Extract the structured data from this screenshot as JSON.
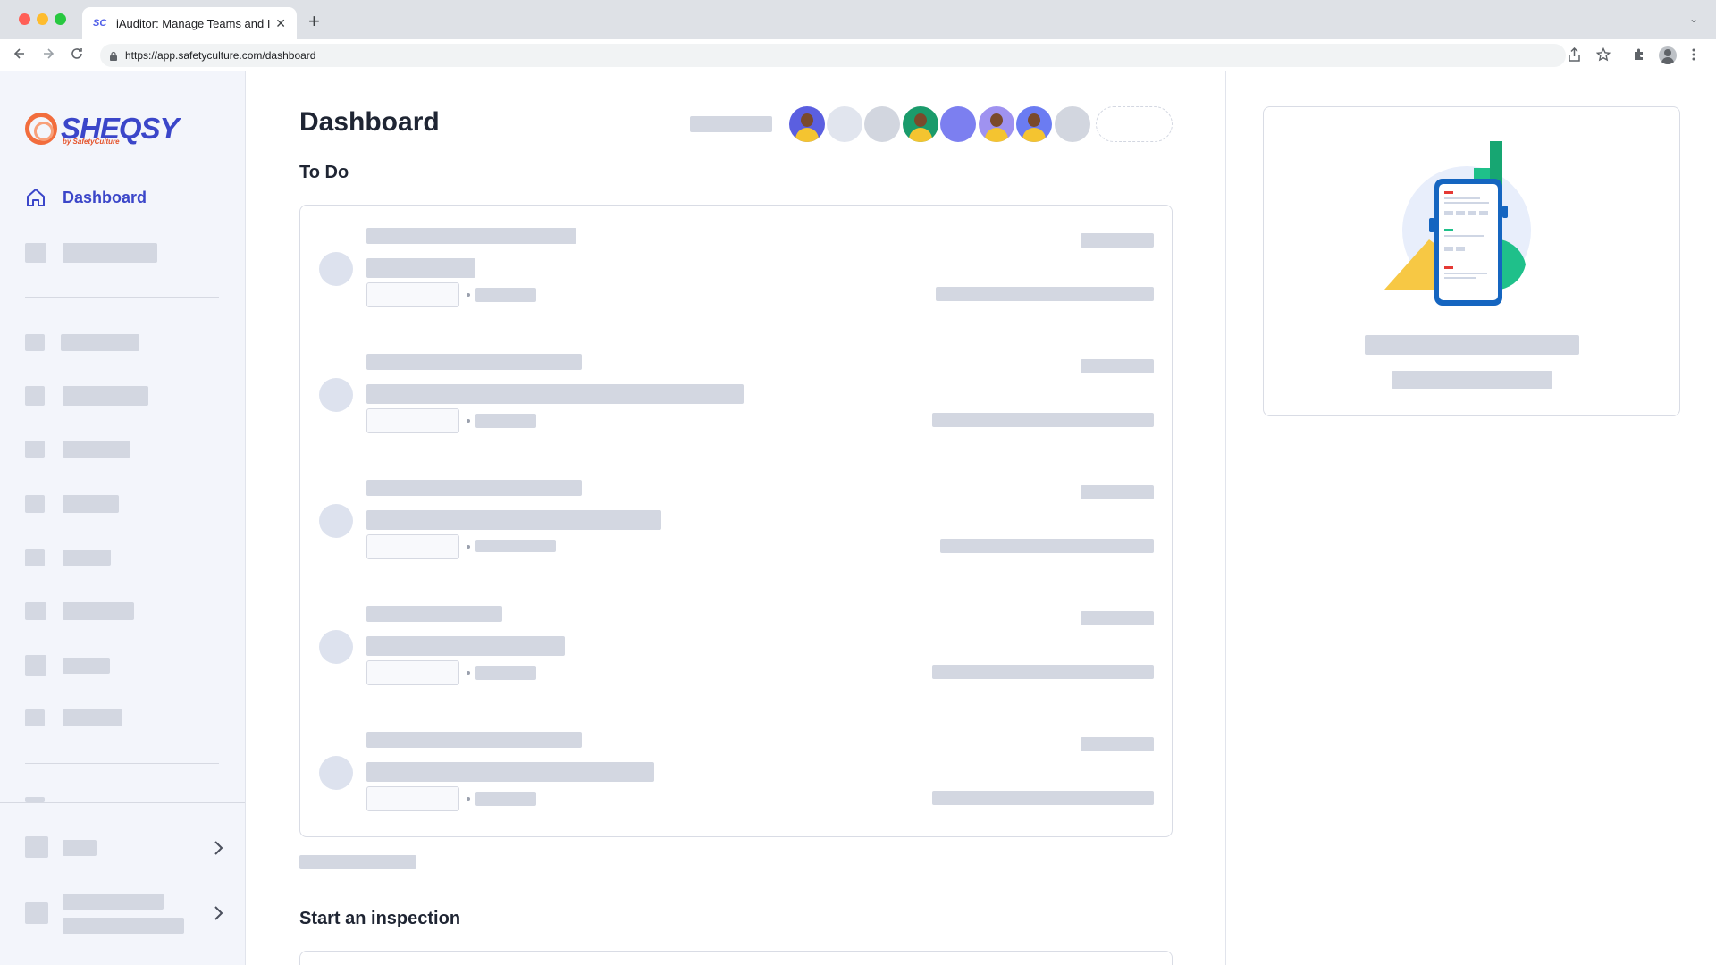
{
  "browser": {
    "tab_favicon": "SC",
    "tab_title": "iAuditor: Manage Teams and Inspections",
    "tab_close": "✕",
    "new_tab": "+",
    "tab_menu": "⌄",
    "url": "https://app.safetyculture.com/dashboard",
    "icons": [
      "back-icon",
      "forward-icon",
      "reload-icon",
      "lock-icon",
      "share-icon",
      "star-icon",
      "extensions-icon",
      "profile-icon",
      "kebab-menu-icon"
    ]
  },
  "sidebar": {
    "logo_text": "SHEQSY",
    "logo_sub": "by SafetyCulture",
    "active_item": "Dashboard",
    "brand_color": "#3b46c9"
  },
  "main": {
    "title": "Dashboard",
    "todo_title": "To Do",
    "start_title": "Start an inspection",
    "avatar_colors": [
      "#5b5fe0",
      "#e1e5ee",
      "#d2d6df",
      "#1a9b6b",
      "#7c7ff0",
      "#9f92f0",
      "#6b7cf2",
      "#d2d6df"
    ]
  }
}
